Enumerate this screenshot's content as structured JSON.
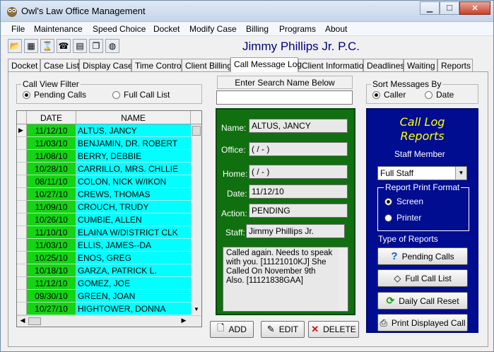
{
  "window": {
    "title": "Owl's Law Office Management"
  },
  "menu": [
    "File",
    "Maintenance",
    "Speed Choice",
    "Docket",
    "Modify Case",
    "Billing",
    "Programs",
    "About"
  ],
  "toolbar_icons": [
    "open-folder-icon",
    "calendar-icon",
    "hourglass-icon",
    "phone-icon",
    "calculator-icon",
    "documents-icon",
    "globe-icon"
  ],
  "firm_name": "Jimmy Phillips Jr. P.C.",
  "tabs": [
    "Docket",
    "Case List",
    "Display Case",
    "Time Control",
    "Client Billing",
    "Call Message Log",
    "Client Information",
    "Deadlines",
    "Waiting",
    "Reports"
  ],
  "active_tab": "Call Message Log",
  "call_view_filter": {
    "title": "Call View Filter",
    "options": [
      "Pending Calls",
      "Full Call List"
    ],
    "selected": "Pending Calls"
  },
  "search": {
    "label": "Enter Search Name Below",
    "value": ""
  },
  "sort": {
    "title": "Sort Messages By",
    "options": [
      "Caller",
      "Date"
    ],
    "selected": "Caller"
  },
  "grid": {
    "headers": [
      "DATE",
      "NAME"
    ],
    "rows": [
      {
        "date": "11/12/10",
        "name": "ALTUS, JANCY"
      },
      {
        "date": "11/03/10",
        "name": "BENJAMIN, DR. ROBERT"
      },
      {
        "date": "11/08/10",
        "name": "BERRY, DEBBIE"
      },
      {
        "date": "10/28/10",
        "name": "CARRILLO, MRS. CHLLIE"
      },
      {
        "date": "08/11/10",
        "name": "COLON, NICK W/IKON"
      },
      {
        "date": "10/27/10",
        "name": "CREWS, THOMAS"
      },
      {
        "date": "11/09/10",
        "name": "CROUCH, TRUDY"
      },
      {
        "date": "10/26/10",
        "name": "CUMBIE, ALLEN"
      },
      {
        "date": "11/10/10",
        "name": "ELAINA W/DISTRICT CLK"
      },
      {
        "date": "11/03/10",
        "name": "ELLIS, JAMES--DA"
      },
      {
        "date": "10/25/10",
        "name": "ENOS, GREG"
      },
      {
        "date": "10/18/10",
        "name": "GARZA, PATRICK L."
      },
      {
        "date": "11/12/10",
        "name": "GOMEZ, JOE"
      },
      {
        "date": "09/30/10",
        "name": "GREEN, JOAN"
      },
      {
        "date": "10/27/10",
        "name": "HIGHTOWER, DONNA"
      }
    ]
  },
  "detail": {
    "name_label": "Name:",
    "name": "ALTUS, JANCY",
    "office_label": "Office:",
    "office": "(  /  -  )",
    "home_label": "Home:",
    "home": "(  /  -  )",
    "date_label": "Date:",
    "date": "11/12/10",
    "action_label": "Action:",
    "action": "PENDING",
    "staff_label": "Staff:",
    "staff": "Jimmy Phillips Jr.",
    "notes": "Called again. Needs to speak with you.  [11121010KJ] She Called On November 9th Also. [11121838GAA]"
  },
  "buttons": {
    "add": "ADD",
    "edit": "EDIT",
    "delete": "DELETE"
  },
  "reports": {
    "title_line1": "Call Log",
    "title_line2": "Reports",
    "staff_label": "Staff Member",
    "staff_selected": "Full Staff",
    "format_title": "Report Print Format",
    "format_options": [
      "Screen",
      "Printer"
    ],
    "format_selected": "Screen",
    "types_label": "Type of Reports",
    "pending_calls": "Pending Calls",
    "full_call_list": "Full Call List",
    "daily_call_reset": "Daily Call Reset",
    "print_displayed_call": "Print Displayed Call"
  }
}
